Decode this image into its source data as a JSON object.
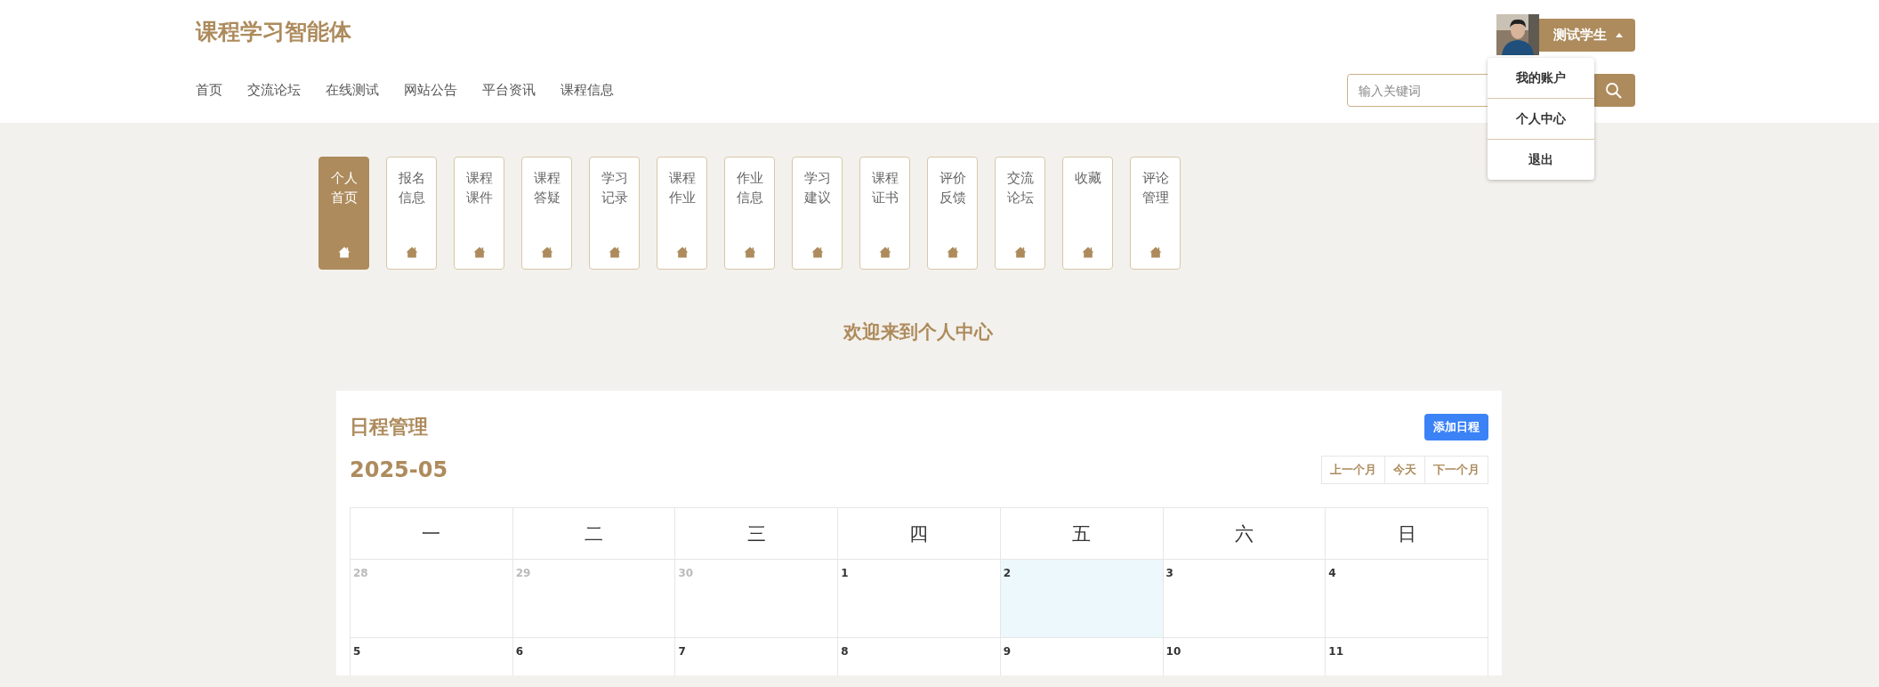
{
  "header": {
    "logo": "课程学习智能体",
    "nav": [
      "首页",
      "交流论坛",
      "在线测试",
      "网站公告",
      "平台资讯",
      "课程信息"
    ],
    "user": {
      "name": "测试学生",
      "menu_open": true
    },
    "user_menu": [
      "我的账户",
      "个人中心",
      "退出"
    ],
    "search": {
      "placeholder": "输入关键词"
    }
  },
  "side_tabs": [
    {
      "label": "个人首页",
      "selected": true
    },
    {
      "label": "报名信息",
      "selected": false
    },
    {
      "label": "课程课件",
      "selected": false
    },
    {
      "label": "课程答疑",
      "selected": false
    },
    {
      "label": "学习记录",
      "selected": false
    },
    {
      "label": "课程作业",
      "selected": false
    },
    {
      "label": "作业信息",
      "selected": false
    },
    {
      "label": "学习建议",
      "selected": false
    },
    {
      "label": "课程证书",
      "selected": false
    },
    {
      "label": "评价反馈",
      "selected": false
    },
    {
      "label": "交流论坛",
      "selected": false
    },
    {
      "label": "收藏",
      "selected": false
    },
    {
      "label": "评论管理",
      "selected": false
    }
  ],
  "welcome": "欢迎来到个人中心",
  "schedule": {
    "title": "日程管理",
    "add_button": "添加日程",
    "month": "2025-05",
    "month_buttons": [
      "上一个月",
      "今天",
      "下一个月"
    ],
    "weekdays": [
      "一",
      "二",
      "三",
      "四",
      "五",
      "六",
      "日"
    ],
    "weeks": [
      [
        {
          "day": "28",
          "other_month": true,
          "today": false
        },
        {
          "day": "29",
          "other_month": true,
          "today": false
        },
        {
          "day": "30",
          "other_month": true,
          "today": false
        },
        {
          "day": "1",
          "other_month": false,
          "today": false
        },
        {
          "day": "2",
          "other_month": false,
          "today": true
        },
        {
          "day": "3",
          "other_month": false,
          "today": false
        },
        {
          "day": "4",
          "other_month": false,
          "today": false
        }
      ],
      [
        {
          "day": "5",
          "other_month": false,
          "today": false
        },
        {
          "day": "6",
          "other_month": false,
          "today": false
        },
        {
          "day": "7",
          "other_month": false,
          "today": false
        },
        {
          "day": "8",
          "other_month": false,
          "today": false
        },
        {
          "day": "9",
          "other_month": false,
          "today": false
        },
        {
          "day": "10",
          "other_month": false,
          "today": false
        },
        {
          "day": "11",
          "other_month": false,
          "today": false
        }
      ]
    ]
  }
}
